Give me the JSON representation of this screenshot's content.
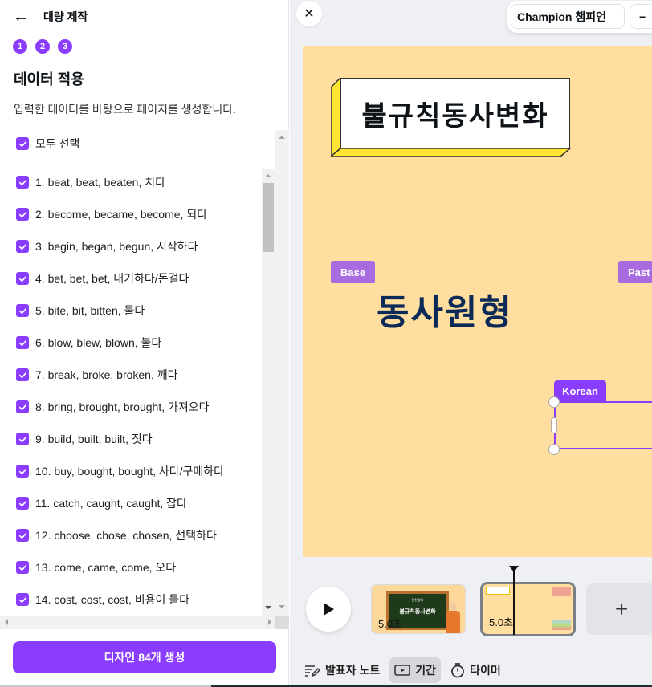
{
  "panel": {
    "back_icon": "arrow-left-icon",
    "title": "대량 제작",
    "steps": [
      "1",
      "2",
      "3"
    ],
    "section_title": "데이터 적용",
    "section_desc": "입력한 데이터를 바탕으로 페이지를 생성합니다.",
    "select_all": {
      "label": "모두 선택",
      "checked": true
    },
    "items": [
      {
        "label": "1. beat, beat, beaten, 치다",
        "checked": true
      },
      {
        "label": "2. become, became, become, 되다",
        "checked": true
      },
      {
        "label": "3. begin, began, begun, 시작하다",
        "checked": true
      },
      {
        "label": "4. bet, bet, bet, 내기하다/돈걸다",
        "checked": true
      },
      {
        "label": "5. bite, bit, bitten, 물다",
        "checked": true
      },
      {
        "label": "6. blow, blew, blown, 불다",
        "checked": true
      },
      {
        "label": "7. break, broke, broken, 깨다",
        "checked": true
      },
      {
        "label": "8. bring, brought, brought, 가져오다",
        "checked": true
      },
      {
        "label": "9. build, built, built, 짓다",
        "checked": true
      },
      {
        "label": "10. buy, bought, bought, 사다/구매하다",
        "checked": true
      },
      {
        "label": "11. catch, caught, caught, 잡다",
        "checked": true
      },
      {
        "label": "12. choose, chose, chosen, 선택하다",
        "checked": true
      },
      {
        "label": "13. come, came, come, 오다",
        "checked": true
      },
      {
        "label": "14. cost, cost, cost, 비용이 들다",
        "checked": true
      }
    ],
    "generate_button": "디자인 84개 생성"
  },
  "editor": {
    "close_icon": "close-icon",
    "font_name": "Champion 챔피언",
    "font_size_decrease": "−",
    "canvas": {
      "title": "불규칙동사변화",
      "tag_base": "Base",
      "tag_past": "Past",
      "heading": "동사원형",
      "tag_korean": "Korean",
      "background": "#ffde9f",
      "accent": "#8b3dff"
    },
    "timeline": {
      "play_icon": "play-icon",
      "pages": [
        {
          "duration": "5.0초",
          "thumb_sub": "알찬영어",
          "thumb_title": "불규칙동사변화"
        },
        {
          "duration": "5.0초",
          "selected": true
        }
      ],
      "add_page": "+"
    },
    "bottom_bar": [
      {
        "label": "발표자 노트",
        "icon": "notes-pen-icon",
        "active": false
      },
      {
        "label": "기간",
        "icon": "duration-play-icon",
        "active": true
      },
      {
        "label": "타이머",
        "icon": "stopwatch-icon",
        "active": false
      }
    ]
  }
}
